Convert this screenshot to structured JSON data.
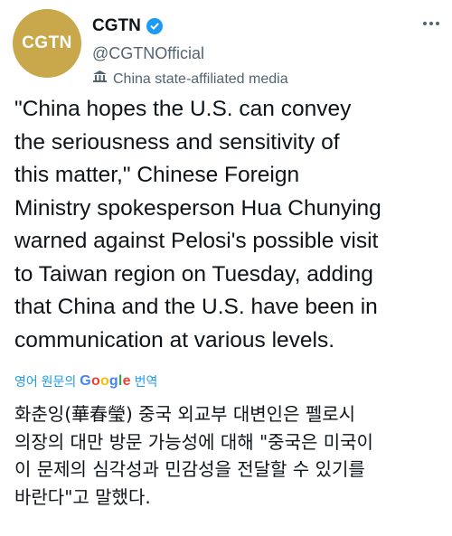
{
  "account": {
    "avatar_text": "CGTN",
    "display_name": "CGTN",
    "handle": "@CGTNOfficial",
    "affiliation_label": "China state-affiliated media",
    "verified": true
  },
  "tweet": {
    "text": "\"China hopes the U.S. can convey\nthe seriousness and sensitivity of\nthis matter,\" Chinese Foreign\nMinistry spokesperson Hua Chunying\nwarned against Pelosi's possible visit\nto Taiwan region on Tuesday, adding\nthat China and the U.S. have been in\ncommunication at various levels."
  },
  "translation": {
    "prefix": "영어 원문의",
    "brand": "Google",
    "suffix": "번역",
    "text": "화춘잉(華春瑩) 중국 외교부 대변인은 펠로시\n의장의 대만 방문 가능성에 대해 \"중국은 미국이\n이 문제의 심각성과 민감성을 전달할 수 있기를\n바란다\"고 말했다."
  },
  "colors": {
    "avatar_bg": "#c8a84a",
    "verified": "#1d9bf0",
    "link": "#1d9bf0",
    "secondary_text": "#536471"
  },
  "icons": [
    "verified-badge-icon",
    "more-options-icon",
    "state-media-icon",
    "google-logo"
  ]
}
